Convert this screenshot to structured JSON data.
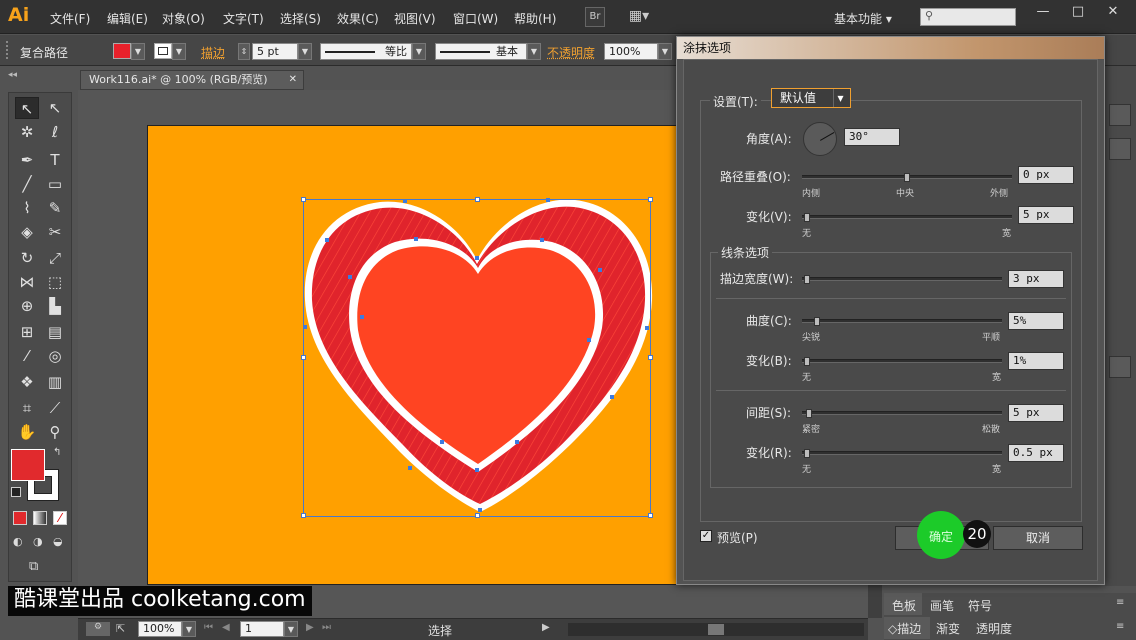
{
  "app": {
    "logo": "Ai"
  },
  "menu": [
    "文件(F)",
    "编辑(E)",
    "对象(O)",
    "文字(T)",
    "选择(S)",
    "效果(C)",
    "视图(V)",
    "窗口(W)",
    "帮助(H)"
  ],
  "topbar": {
    "bridge": "Br",
    "workspace": "基本功能",
    "workspace_arrow": "▾",
    "minimize": "—",
    "maximize": "□",
    "close": "✕"
  },
  "control": {
    "object_type": "复合路径",
    "fill_color": "#e8212b",
    "stroke_label": "描边",
    "stroke_weight": "5 pt",
    "profile_label": "等比",
    "brush_label": "基本",
    "opacity_label": "不透明度",
    "opacity_value": "100%"
  },
  "document": {
    "tab_title": "Work116.ai* @ 100% (RGB/预览)",
    "tab_close": "✕"
  },
  "tools": {
    "fill_color": "#e12a2d",
    "stroke_color": "#ffffff"
  },
  "dialog": {
    "title": "涂抹选项",
    "settings_label": "设置(T):",
    "settings_value": "默认值",
    "angle_label": "角度(A):",
    "angle_value": "30°",
    "path_overlap_label": "路径重叠(O):",
    "path_overlap_value": "0 px",
    "path_overlap_min": "内侧",
    "path_overlap_mid": "中央",
    "path_overlap_max": "外侧",
    "variation1_label": "变化(V):",
    "variation1_value": "5 px",
    "variation1_min": "无",
    "variation1_max": "宽",
    "line_options_label": "线条选项",
    "stroke_width_label": "描边宽度(W):",
    "stroke_width_value": "3 px",
    "curviness_label": "曲度(C):",
    "curviness_value": "5%",
    "curviness_min": "尖锐",
    "curviness_max": "平顺",
    "variation2_label": "变化(B):",
    "variation2_value": "1%",
    "variation2_min": "无",
    "variation2_max": "宽",
    "spacing_label": "间距(S):",
    "spacing_value": "5 px",
    "spacing_min": "紧密",
    "spacing_max": "松散",
    "variation3_label": "变化(R):",
    "variation3_value": "0.5 px",
    "variation3_min": "无",
    "variation3_max": "宽",
    "preview_label": "预览(P)",
    "ok_label": "确定",
    "cancel_label": "取消"
  },
  "overlay": {
    "step_number": "20",
    "watermark": "酷课堂出品 coolketang.com"
  },
  "panels": {
    "tab_swatches": "色板",
    "tab_brushes": "画笔",
    "tab_symbols": "符号",
    "tab_stroke": "描边",
    "tab_gradient": "渐变",
    "tab_transparency": "透明度"
  },
  "status": {
    "zoom": "100%",
    "page": "1",
    "tool_name": "选择"
  }
}
